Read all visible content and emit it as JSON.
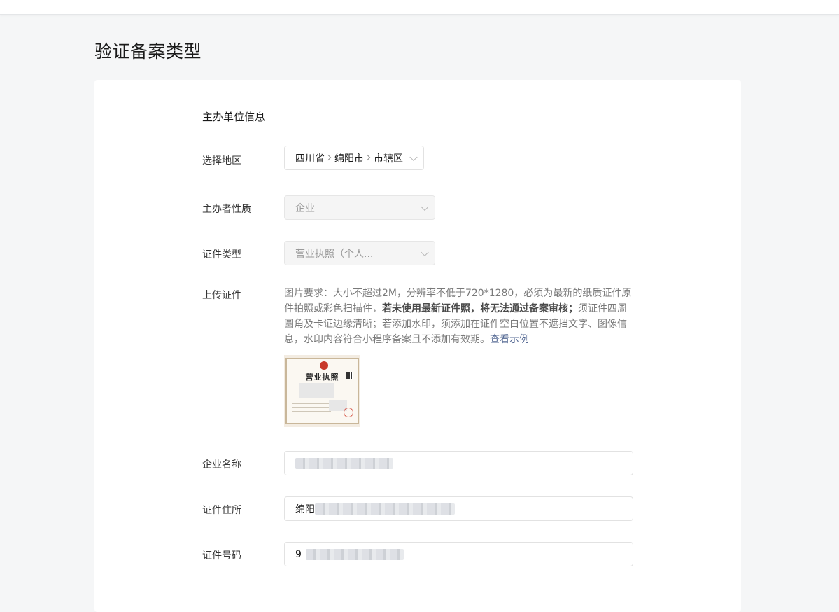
{
  "page": {
    "title": "验证备案类型"
  },
  "section": {
    "title": "主办单位信息"
  },
  "region": {
    "label": "选择地区",
    "province": "四川省",
    "city": "绵阳市",
    "district": "市辖区"
  },
  "organizer_type": {
    "label": "主办者性质",
    "value": "企业"
  },
  "cert_type": {
    "label": "证件类型",
    "value": "营业执照（个人..."
  },
  "upload": {
    "label": "上传证件",
    "desc_part1": "图片要求：大小不超过2M，分辨率不低于720*1280，必须为最新的纸质证件原件拍照或彩色扫描件，",
    "desc_bold": "若未使用最新证件照，将无法通过备案审核；",
    "desc_part2": "须证件四周圆角及卡证边缘清晰；若添加水印，须添加在证件空白位置不遮挡文字、图像信息，水印内容符合小程序备案且不添加有效期。",
    "example_link": "查看示例",
    "thumb_title": "营业执照"
  },
  "company_name": {
    "label": "企业名称",
    "value": ""
  },
  "cert_address": {
    "label": "证件住所",
    "value_prefix": "绵阳"
  },
  "cert_number": {
    "label": "证件号码",
    "value_prefix": "9"
  },
  "colors": {
    "link": "#576b95",
    "background": "#f5f6f7",
    "card": "#ffffff"
  }
}
